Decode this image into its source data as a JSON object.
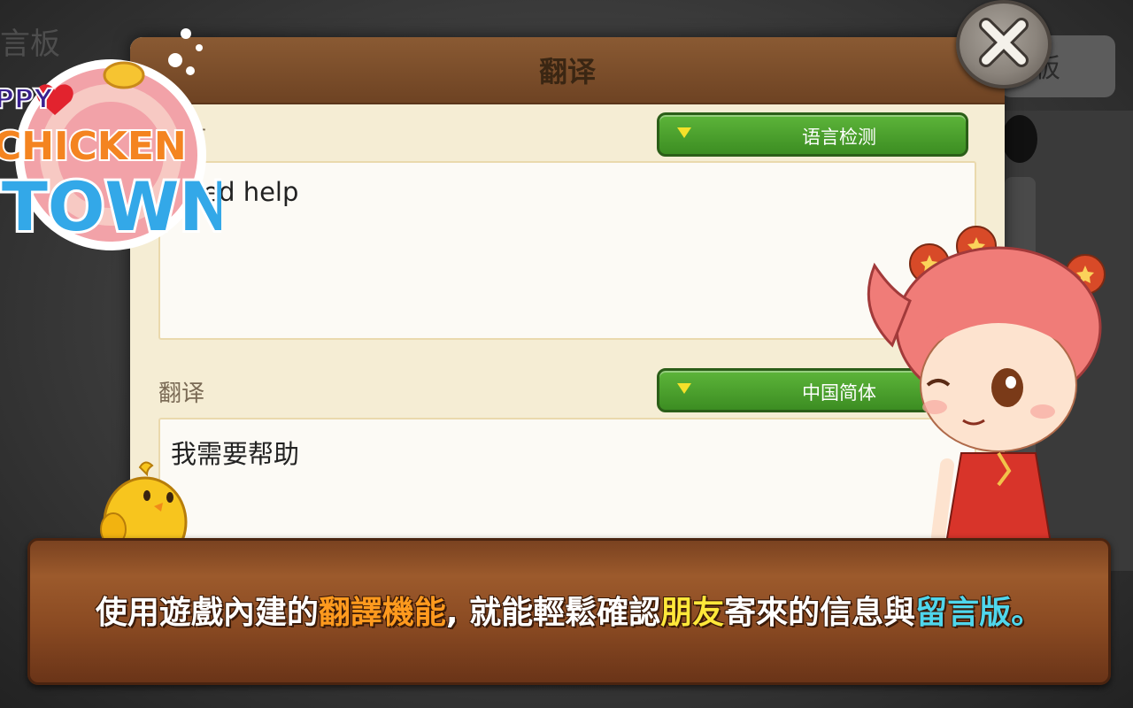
{
  "background": {
    "top_left_text": "言板",
    "right_panel_text": "板"
  },
  "dialog": {
    "title": "翻译",
    "source": {
      "label": "文",
      "language_button": "语言检测",
      "text": "need help"
    },
    "target": {
      "label": "翻译",
      "language_button": "中国简体",
      "text": "我需要帮助"
    },
    "close_icon": "close-x-icon"
  },
  "logo": {
    "line1": "PPY",
    "line2": "CHICKEN",
    "line3": "TOWN"
  },
  "banner": {
    "part1": "使用遊戲內建的",
    "highlight1": "翻譯機能",
    "part2": ", 就能輕鬆確認",
    "highlight2": "朋友",
    "part3": "寄來的信息與",
    "highlight3": "留言版",
    "part4": "。"
  },
  "colors": {
    "button_green": "#4aa12e",
    "header_brown": "#7a4c2a",
    "highlight_orange": "#ff9a1e",
    "highlight_yellow": "#ffe83a",
    "highlight_cyan": "#4fd6ec"
  }
}
